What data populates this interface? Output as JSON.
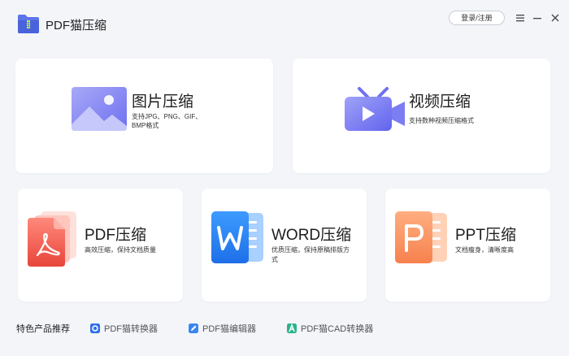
{
  "app": {
    "title": "PDF猫压缩"
  },
  "header": {
    "login_label": "登录/注册"
  },
  "window_controls": [
    "menu-icon",
    "minimize-icon",
    "close-icon"
  ],
  "cards": {
    "image": {
      "title": "图片压缩",
      "desc_line1": "支持JPG、PNG、GIF、",
      "desc_line2": "BMP格式"
    },
    "video": {
      "title": "视频压缩",
      "desc": "支持数种视频压缩格式"
    },
    "pdf": {
      "title": "PDF压缩",
      "desc": "高效压缩，保持文档质量"
    },
    "word": {
      "title": "WORD压缩",
      "desc_line1": "优质压缩，保持原稿排版方",
      "desc_line2": "式"
    },
    "ppt": {
      "title": "PPT压缩",
      "desc": "文档瘦身，清晰度高"
    }
  },
  "footer": {
    "feature_label": "特色产品推荐",
    "products": [
      {
        "label": "PDF猫转换器",
        "icon": "pdf-converter-icon",
        "color": "#2f6fe8"
      },
      {
        "label": "PDF猫编辑器",
        "icon": "pdf-editor-icon",
        "color": "#3a86f0"
      },
      {
        "label": "PDF猫CAD转换器",
        "icon": "cad-converter-icon",
        "color": "#2bb38a"
      }
    ]
  },
  "colors": {
    "background": "#f3f5f9",
    "card": "#ffffff",
    "accent": "#6a6cf0"
  }
}
